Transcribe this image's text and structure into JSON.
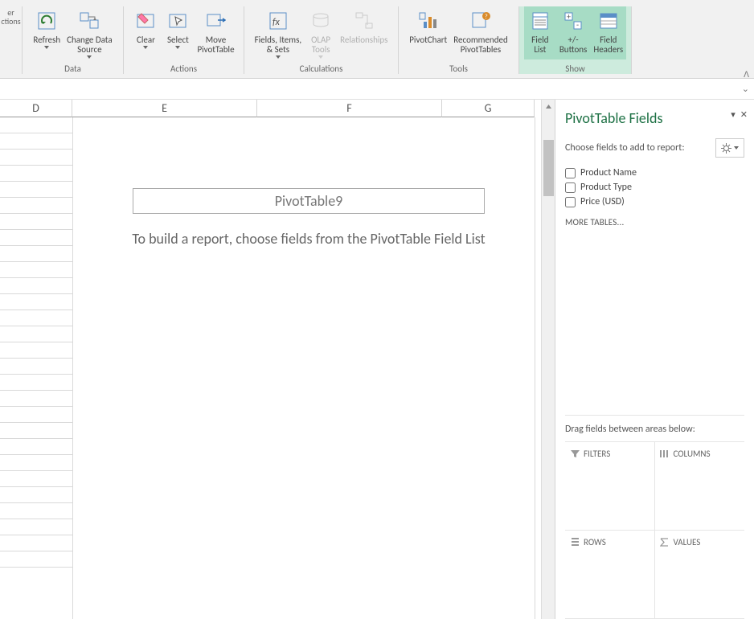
{
  "ribbon": {
    "partial_left": {
      "label": "er\nctions"
    },
    "data": {
      "group": "Data",
      "refresh": "Refresh",
      "change_source": "Change Data\nSource"
    },
    "actions": {
      "group": "Actions",
      "clear": "Clear",
      "select": "Select",
      "move": "Move\nPivotTable"
    },
    "calculations": {
      "group": "Calculations",
      "fields": "Fields, Items,\n& Sets",
      "olap": "OLAP\nTools",
      "relationships": "Relationships"
    },
    "tools": {
      "group": "Tools",
      "pivotchart": "PivotChart",
      "recommended": "Recommended\nPivotTables"
    },
    "show": {
      "group": "Show",
      "fieldlist": "Field\nList",
      "pmbuttons": "+/-\nButtons",
      "fieldheaders": "Field\nHeaders"
    }
  },
  "columns": [
    "D",
    "E",
    "F",
    "G"
  ],
  "pivot": {
    "name": "PivotTable9",
    "hint": "To build a report, choose fields from the PivotTable Field List"
  },
  "pane": {
    "title": "PivotTable Fields",
    "subtitle": "Choose fields to add to report:",
    "fields": [
      "Product Name",
      "Product Type",
      "Price (USD)"
    ],
    "more_tables": "MORE TABLES...",
    "drag_hint": "Drag fields between areas below:",
    "areas": {
      "filters": "FILTERS",
      "columns": "COLUMNS",
      "rows": "ROWS",
      "values": "VALUES"
    }
  }
}
